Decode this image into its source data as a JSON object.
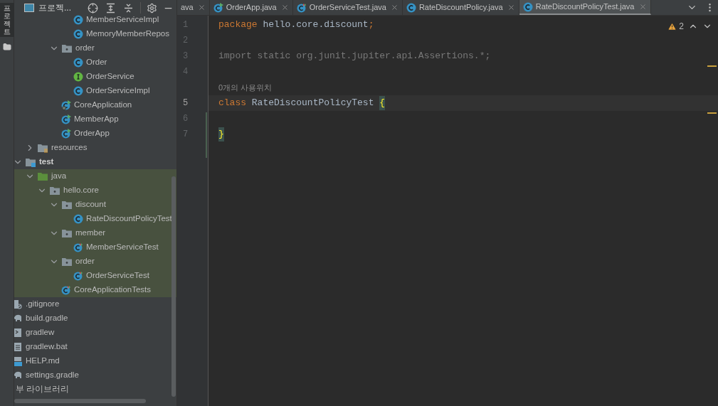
{
  "tool_strip": {
    "label": "프로젝트",
    "selected": true
  },
  "project_panel": {
    "title": "프로젝...",
    "tree": [
      {
        "children": [
          {
            "children": [
              {
                "children": [
                  {
                    "children": [
                      {
                        "children": [
                          {
                            "children": [
                              {
                                "label": "MemberServiceImpl",
                                "kind": "class",
                                "highlighted": false
                              },
                              {
                                "label": "MemoryMemberRepos",
                                "kind": "class",
                                "highlighted": false
                              }
                            ]
                          },
                          {
                            "label": "order",
                            "kind": "package",
                            "expanded": true,
                            "highlighted": false,
                            "children": [
                              {
                                "label": "Order",
                                "kind": "class",
                                "highlighted": false
                              },
                              {
                                "label": "OrderService",
                                "kind": "interface",
                                "highlighted": false
                              },
                              {
                                "label": "OrderServiceImpl",
                                "kind": "class",
                                "highlighted": false
                              }
                            ]
                          },
                          {
                            "label": "CoreApplication",
                            "kind": "spring-app",
                            "highlighted": false
                          },
                          {
                            "label": "MemberApp",
                            "kind": "app",
                            "highlighted": false
                          },
                          {
                            "label": "OrderApp",
                            "kind": "app",
                            "highlighted": false
                          }
                        ]
                      }
                    ]
                  },
                  {
                    "label": "resources",
                    "kind": "resources",
                    "expanded": false,
                    "highlighted": false
                  }
                ]
              },
              {
                "label": "test",
                "kind": "test-root",
                "expanded": true,
                "highlighted": false,
                "children": [
                  {
                    "label": "java",
                    "kind": "source-root",
                    "expanded": true,
                    "highlighted": true,
                    "children": [
                      {
                        "label": "hello.core",
                        "kind": "package",
                        "expanded": true,
                        "highlighted": true,
                        "children": [
                          {
                            "label": "discount",
                            "kind": "package",
                            "expanded": true,
                            "highlighted": true,
                            "children": [
                              {
                                "label": "RateDiscountPolicyTest",
                                "kind": "class",
                                "highlighted": true
                              }
                            ]
                          },
                          {
                            "label": "member",
                            "kind": "package",
                            "expanded": true,
                            "highlighted": true,
                            "children": [
                              {
                                "label": "MemberServiceTest",
                                "kind": "test",
                                "highlighted": true
                              }
                            ]
                          },
                          {
                            "label": "order",
                            "kind": "package",
                            "expanded": true,
                            "highlighted": true,
                            "children": [
                              {
                                "label": "OrderServiceTest",
                                "kind": "test",
                                "highlighted": true
                              }
                            ]
                          },
                          {
                            "label": "CoreApplicationTests",
                            "kind": "test",
                            "highlighted": true
                          }
                        ]
                      }
                    ]
                  }
                ]
              }
            ]
          },
          {
            "label": ".gitignore",
            "kind": "ignore",
            "highlighted": false
          },
          {
            "label": "build.gradle",
            "kind": "gradle",
            "highlighted": false
          },
          {
            "label": "gradlew",
            "kind": "script",
            "highlighted": false
          },
          {
            "label": "gradlew.bat",
            "kind": "text-file",
            "highlighted": false
          },
          {
            "label": "HELP.md",
            "kind": "markdown",
            "highlighted": false
          },
          {
            "label": "settings.gradle",
            "kind": "gradle",
            "highlighted": false
          }
        ]
      },
      {
        "label": "부 라이브러리",
        "highlighted": false
      }
    ]
  },
  "tabs": [
    {
      "label": "ava",
      "selected": false
    },
    {
      "label": "OrderApp.java",
      "kind": "app",
      "selected": false
    },
    {
      "label": "OrderServiceTest.java",
      "kind": "test",
      "selected": false
    },
    {
      "label": "RateDiscountPolicy.java",
      "kind": "class",
      "selected": false
    },
    {
      "label": "RateDiscountPolicyTest.java",
      "kind": "class",
      "selected": true
    }
  ],
  "editor": {
    "warnings": "2",
    "lines": [
      {
        "kind": "code",
        "number": "1",
        "current": false,
        "tokens": [
          {
            "text": "package",
            "kind": "keyword"
          },
          {
            "text": " hello.core.discount",
            "kind": "plain"
          },
          {
            "text": ";",
            "kind": "keyword"
          }
        ]
      },
      {
        "kind": "code",
        "number": "2",
        "current": false
      },
      {
        "kind": "code",
        "number": "3",
        "current": false,
        "tokens": [
          {
            "text": "import static org.junit.jupiter.api.Assertions.*;",
            "kind": "unused"
          }
        ]
      },
      {
        "kind": "code",
        "number": "4",
        "current": false
      },
      {
        "kind": "hint",
        "text": "0개의 사용위치"
      },
      {
        "kind": "code",
        "number": "5",
        "current": true,
        "tokens": [
          {
            "text": "class",
            "kind": "keyword"
          },
          {
            "text": " RateDiscountPolicyTest ",
            "kind": "plain"
          },
          {
            "text": "{",
            "kind": "brace-match"
          }
        ]
      },
      {
        "kind": "code",
        "number": "6",
        "current": false
      },
      {
        "kind": "code",
        "number": "7",
        "current": false,
        "tokens": [
          {
            "text": "}",
            "kind": "brace-match"
          }
        ]
      }
    ]
  }
}
